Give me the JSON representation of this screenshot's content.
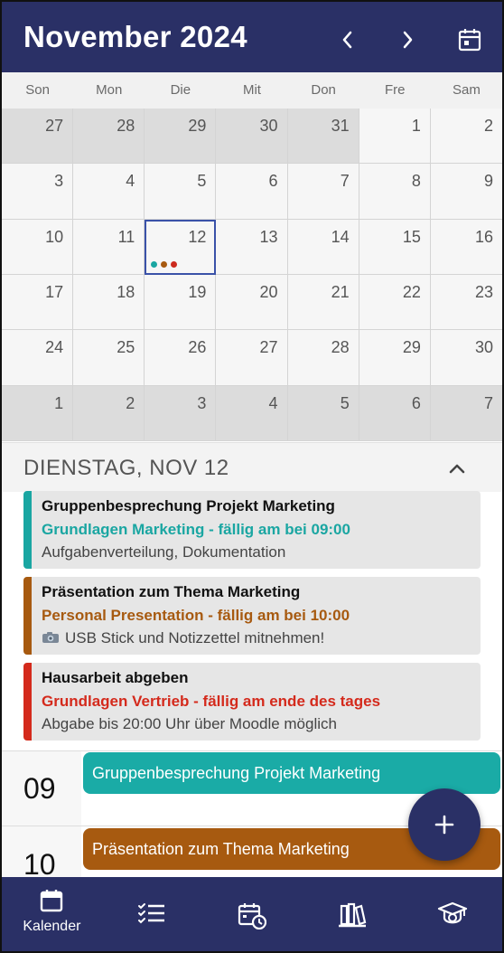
{
  "header": {
    "title": "November 2024"
  },
  "weekdays": [
    "Son",
    "Mon",
    "Die",
    "Mit",
    "Don",
    "Fre",
    "Sam"
  ],
  "calendar": {
    "weeks": [
      [
        "27",
        "28",
        "29",
        "30",
        "31",
        "1",
        "2"
      ],
      [
        "3",
        "4",
        "5",
        "6",
        "7",
        "8",
        "9"
      ],
      [
        "10",
        "11",
        "12",
        "13",
        "14",
        "15",
        "16"
      ],
      [
        "17",
        "18",
        "19",
        "20",
        "21",
        "22",
        "23"
      ],
      [
        "24",
        "25",
        "26",
        "27",
        "28",
        "29",
        "30"
      ],
      [
        "1",
        "2",
        "3",
        "4",
        "5",
        "6",
        "7"
      ]
    ],
    "selected_day": "12",
    "event_dot_colors": [
      "#1aa6a2",
      "#a75a10",
      "#cc2a1e"
    ]
  },
  "day": {
    "title": "DIENSTAG, NOV 12"
  },
  "events": [
    {
      "title": "Gruppenbesprechung Projekt Marketing",
      "subtitle": "Grundlagen Marketing - fällig am bei 09:00",
      "note": "Aufgabenverteilung, Dokumentation",
      "color": "#1aa6a2"
    },
    {
      "title": "Präsentation zum Thema Marketing",
      "subtitle": "Personal Presentation - fällig am bei 10:00",
      "note": "USB Stick und Notizzettel mitnehmen!",
      "color": "#a75a10"
    },
    {
      "title": "Hausarbeit abgeben",
      "subtitle": "Grundlagen Vertrieb - fällig am ende des tages",
      "note": "Abgabe bis 20:00 Uhr über Moodle möglich",
      "color": "#d42a1c"
    }
  ],
  "timeline": {
    "hours": [
      "09",
      "10"
    ],
    "events": [
      {
        "label": "Gruppenbesprechung Projekt Marketing",
        "color": "#1aaba6"
      },
      {
        "label": "Präsentation zum Thema Marketing",
        "color": "#a75a10"
      }
    ]
  },
  "bottom_nav": {
    "items": [
      {
        "icon": "calendar-icon",
        "label": "Kalender",
        "active": true
      },
      {
        "icon": "checklist-icon",
        "label": ""
      },
      {
        "icon": "schedule-icon",
        "label": ""
      },
      {
        "icon": "books-icon",
        "label": ""
      },
      {
        "icon": "graduation-cap-icon",
        "label": ""
      }
    ]
  },
  "colors": {
    "primary": "#2a3066",
    "selected_outline": "#3a52a8"
  }
}
